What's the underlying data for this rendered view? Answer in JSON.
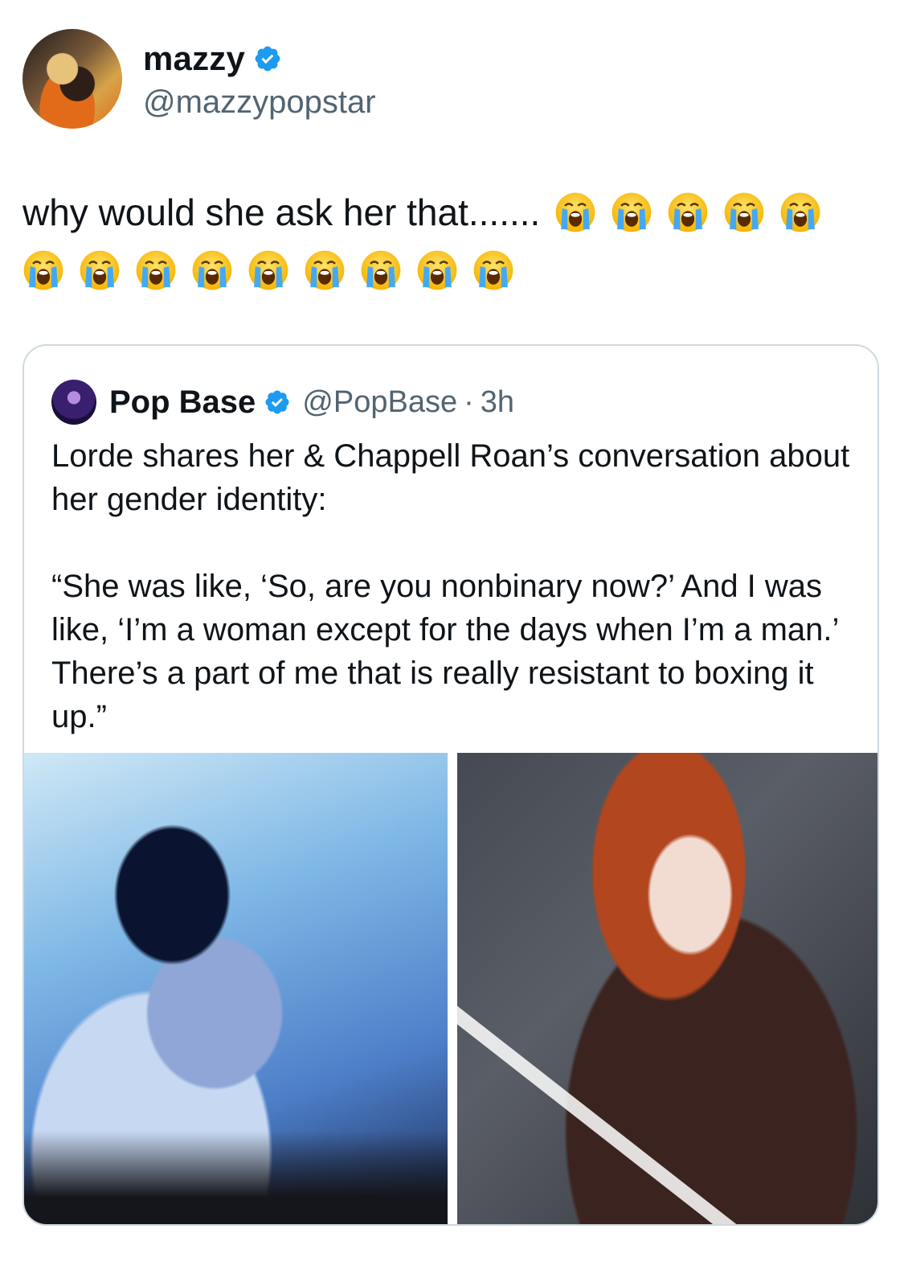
{
  "author": {
    "display_name": "mazzy",
    "handle": "@mazzypopstar",
    "verified_icon": "verified-badge-icon"
  },
  "tweet": {
    "text": "why would she ask her that.......",
    "emoji_icon": "loudly-crying-face-icon",
    "emoji_count_line1": 5,
    "emoji_count_line2": 9
  },
  "quote": {
    "display_name": "Pop Base",
    "handle": "@PopBase",
    "separator": "·",
    "time": "3h",
    "text": "Lorde shares her & Chappell Roan’s conversation about her gender identity:\n\n“She was like, ‘So, are you nonbinary now?’ And I was like, ‘I’m a woman except for the days when I’m a man.’ There’s a part of me that is really resistant to boxing it up.”",
    "media": [
      {
        "name": "photo-left"
      },
      {
        "name": "photo-right"
      }
    ]
  },
  "colors": {
    "verified_blue": "#1d9bf0",
    "muted_text": "#536471",
    "border": "#cfd9de"
  }
}
